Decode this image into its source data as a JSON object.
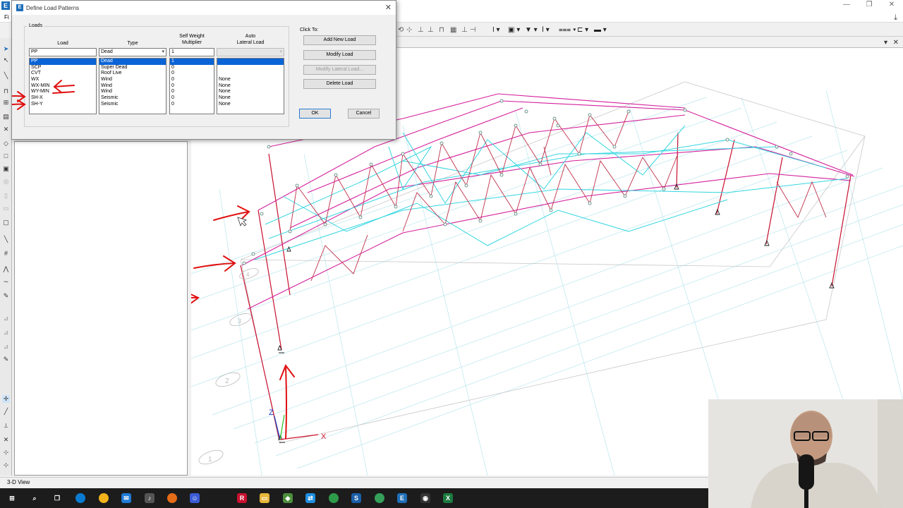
{
  "app": {
    "logo_letter": "E",
    "menu_file": "Fi",
    "status": "3-D View"
  },
  "dialog": {
    "logo_letter": "E",
    "title": "Define Load Patterns",
    "loads_caption": "Loads",
    "columns": {
      "load": "Load",
      "type": "Type",
      "multiplier": [
        "Self Weight",
        "Multiplier"
      ],
      "auto_lateral": [
        "Auto",
        "Lateral Load"
      ]
    },
    "input": {
      "load": "PP",
      "type": "Dead",
      "multiplier": "1",
      "auto_lateral": ""
    },
    "rows": [
      {
        "load": "PP",
        "type": "Dead",
        "multiplier": "1",
        "auto_lateral": "",
        "selected": true
      },
      {
        "load": "SCP",
        "type": "Super Dead",
        "multiplier": "0",
        "auto_lateral": ""
      },
      {
        "load": "CVT",
        "type": "Roof Live",
        "multiplier": "0",
        "auto_lateral": ""
      },
      {
        "load": "WX",
        "type": "Wind",
        "multiplier": "0",
        "auto_lateral": "None"
      },
      {
        "load": "WX-MIN",
        "type": "Wind",
        "multiplier": "0",
        "auto_lateral": "None"
      },
      {
        "load": "WY-MIN",
        "type": "Wind",
        "multiplier": "0",
        "auto_lateral": "None"
      },
      {
        "load": "SH-X",
        "type": "Seismic",
        "multiplier": "0",
        "auto_lateral": "None"
      },
      {
        "load": "SH-Y",
        "type": "Seismic",
        "multiplier": "0",
        "auto_lateral": "None"
      }
    ],
    "click_to_caption": "Click To:",
    "buttons": {
      "add_new": "Add New Load",
      "modify": "Modify Load",
      "modify_lateral": "Modify Lateral Load...",
      "delete": "Delete Load",
      "ok": "OK",
      "cancel": "Cancel"
    }
  },
  "viewport": {
    "axes": {
      "x": "X",
      "z": "Z"
    },
    "grid_labels": [
      "1",
      "2",
      "3",
      "4"
    ]
  },
  "colors": {
    "selection": "#0a64d6",
    "roof_member": "#d41f9c",
    "brace": "#33d6e0",
    "column": "#c8102e",
    "annotation": "#e01010",
    "grid": "#b9e6ee"
  }
}
